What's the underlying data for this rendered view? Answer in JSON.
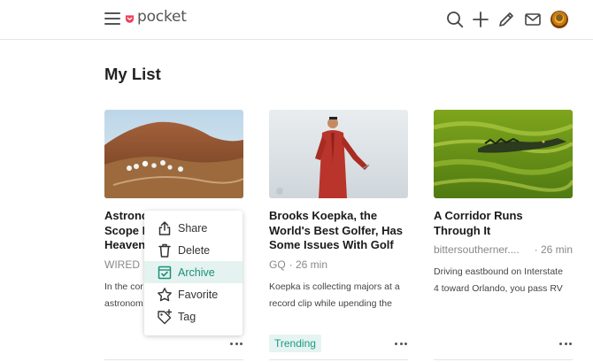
{
  "header": {
    "logo_text": "pocket",
    "icons": [
      "menu-icon",
      "search-icon",
      "add-icon",
      "pencil-icon",
      "mail-icon",
      "avatar"
    ]
  },
  "page": {
    "title": "My List"
  },
  "colors": {
    "brand": "#ef4056",
    "accent": "#1b9a83",
    "menu_active_bg": "#e4f3f0"
  },
  "cards": [
    {
      "title": "Astrono… Scope I… Heaven…",
      "title_lines": [
        "Astrono",
        "Scope I",
        "Heaven"
      ],
      "source": "WIRED",
      "read_time": "",
      "excerpt_lines": [
        "In the cor",
        "astronom"
      ]
    },
    {
      "title_lines": [
        "Brooks Koepka, the",
        "World's Best Golfer, Has",
        "Some Issues With Golf"
      ],
      "source": "GQ",
      "read_time": "· 26 min",
      "excerpt_lines": [
        "Koepka is collecting majors at a",
        "record clip while upending the"
      ],
      "tag": "Trending"
    },
    {
      "title_lines": [
        "A Corridor Runs",
        "Through It"
      ],
      "source": "bittersoutherner....",
      "read_time": "· 26 min",
      "excerpt_lines": [
        "Driving eastbound on Interstate",
        "4 toward Orlando, you pass RV"
      ]
    }
  ],
  "context_menu": {
    "items": [
      {
        "label": "Share",
        "icon": "share-icon"
      },
      {
        "label": "Delete",
        "icon": "trash-icon"
      },
      {
        "label": "Archive",
        "icon": "archive-check-icon",
        "active": true
      },
      {
        "label": "Favorite",
        "icon": "star-icon"
      },
      {
        "label": "Tag",
        "icon": "tag-plus-icon"
      }
    ]
  }
}
